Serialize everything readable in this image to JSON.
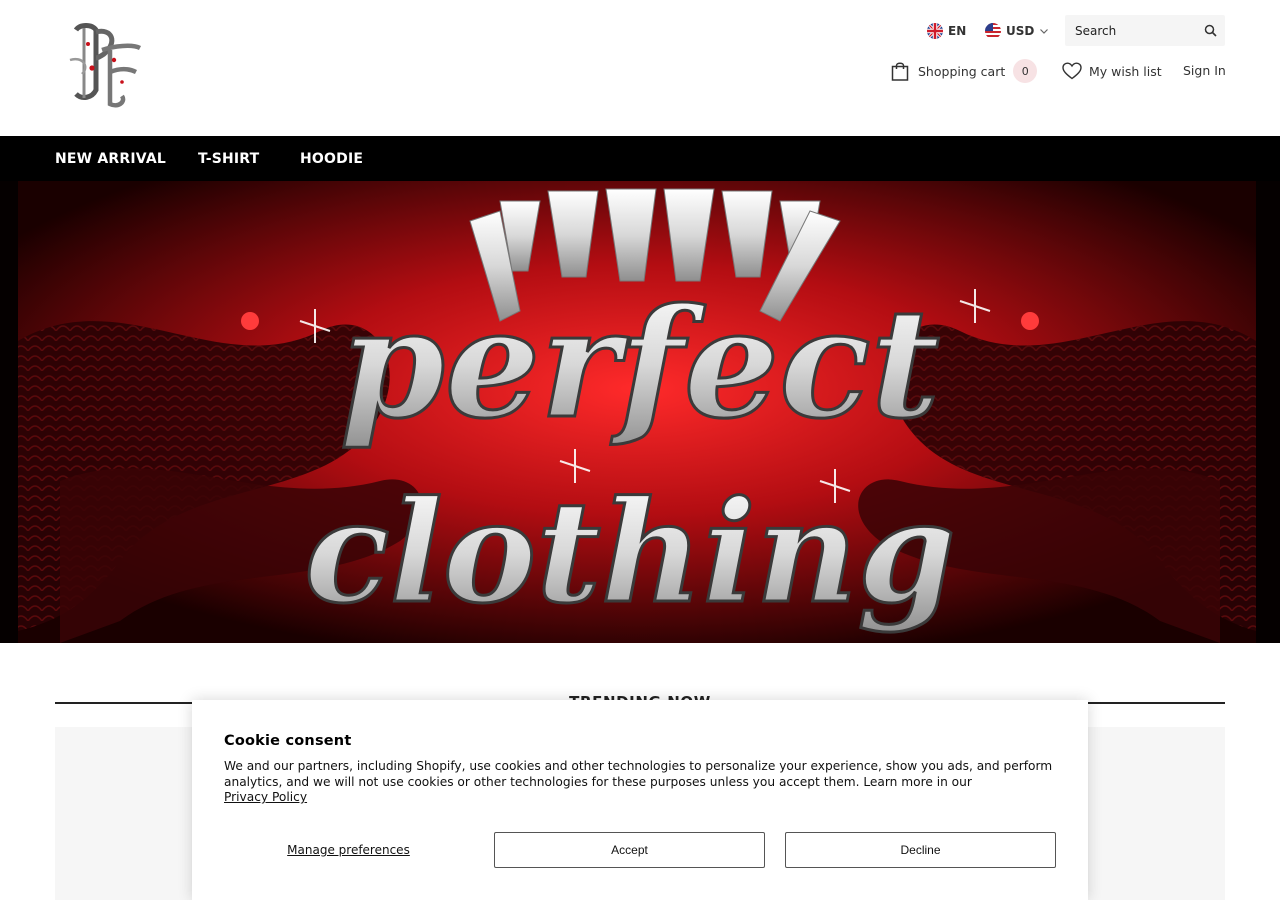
{
  "header": {
    "logo_text": "PF",
    "language": {
      "code": "EN",
      "icon": "uk-flag-icon"
    },
    "currency": {
      "code": "USD",
      "icon": "us-flag-icon"
    },
    "search": {
      "placeholder": "Search"
    },
    "cart": {
      "label": "Shopping cart",
      "count": "0"
    },
    "wishlist": {
      "label": "My wish list"
    },
    "signin": {
      "label": "Sign In"
    }
  },
  "nav": {
    "items": [
      {
        "label": "NEW ARRIVAL"
      },
      {
        "label": "T-SHIRT"
      },
      {
        "label": "HOODIE"
      }
    ]
  },
  "hero": {
    "line1": "perfect",
    "line2": "clothing"
  },
  "trending": {
    "title": "TRENDING NOW"
  },
  "cookie": {
    "title": "Cookie consent",
    "body": "We and our partners, including Shopify, use cookies and other technologies to personalize your experience, show you ads, and perform analytics, and we will not use cookies or other technologies for these purposes unless you accept them. Learn more in our",
    "policy_link": "Privacy Policy",
    "manage": "Manage preferences",
    "accept": "Accept",
    "decline": "Decline"
  },
  "colors": {
    "nav_bg": "#000000",
    "hero_red": "#d4121c",
    "cart_badge_bg": "#f7e2e4"
  }
}
